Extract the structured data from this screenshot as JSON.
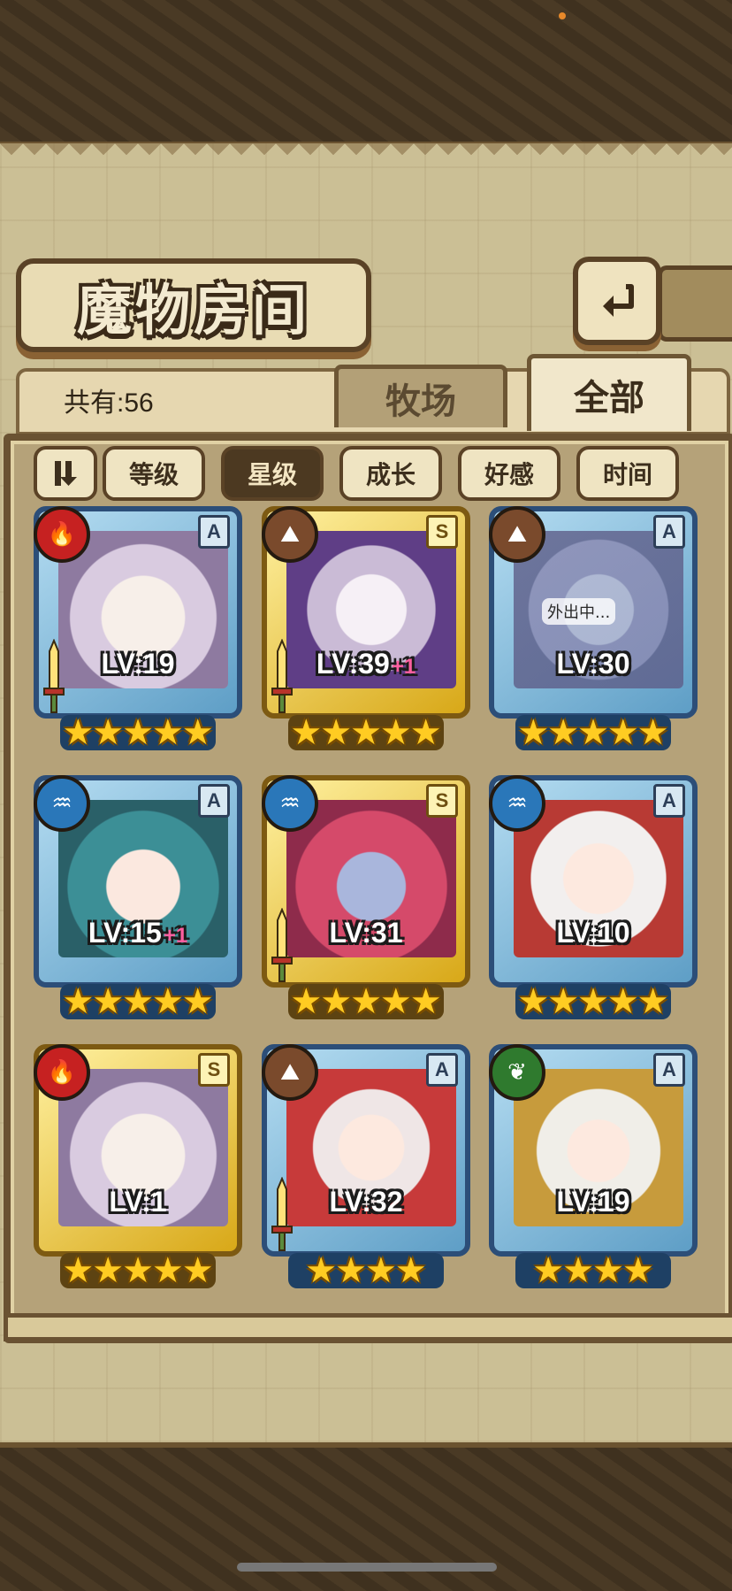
{
  "header": {
    "title": "魔物房间",
    "owned_count": "共有:56"
  },
  "tabs": [
    {
      "label": "牧场",
      "selected": false
    },
    {
      "label": "全部",
      "selected": true
    }
  ],
  "sort": {
    "options": [
      {
        "label": "等级",
        "active": false
      },
      {
        "label": "星级",
        "active": true
      },
      {
        "label": "成长",
        "active": false
      },
      {
        "label": "好感",
        "active": false
      },
      {
        "label": "时间",
        "active": false
      }
    ]
  },
  "monsters": [
    {
      "element": "fire",
      "rank": "A",
      "level": "LV:19",
      "bonus": "",
      "stars": 5,
      "frame": "blue",
      "sword": true,
      "status": ""
    },
    {
      "element": "earth",
      "rank": "S",
      "level": "LV:39",
      "bonus": "+1",
      "stars": 5,
      "frame": "gold",
      "sword": true,
      "status": ""
    },
    {
      "element": "earth",
      "rank": "A",
      "level": "LV:30",
      "bonus": "",
      "stars": 5,
      "frame": "blue",
      "sword": false,
      "status": "外出中..."
    },
    {
      "element": "water",
      "rank": "A",
      "level": "LV:15",
      "bonus": "+1",
      "stars": 5,
      "frame": "blue",
      "sword": false,
      "status": ""
    },
    {
      "element": "water",
      "rank": "S",
      "level": "LV:31",
      "bonus": "",
      "stars": 5,
      "frame": "gold",
      "sword": true,
      "status": ""
    },
    {
      "element": "water",
      "rank": "A",
      "level": "LV:10",
      "bonus": "",
      "stars": 5,
      "frame": "blue",
      "sword": false,
      "status": ""
    },
    {
      "element": "fire",
      "rank": "S",
      "level": "LV:1",
      "bonus": "",
      "stars": 5,
      "frame": "gold",
      "sword": false,
      "status": ""
    },
    {
      "element": "earth",
      "rank": "A",
      "level": "LV:32",
      "bonus": "",
      "stars": 4,
      "frame": "blue",
      "sword": true,
      "status": ""
    },
    {
      "element": "wind",
      "rank": "A",
      "level": "LV:19",
      "bonus": "",
      "stars": 4,
      "frame": "blue",
      "sword": false,
      "status": ""
    }
  ],
  "icons": {
    "back": "return-arrow-icon",
    "sort_toggle": "sort-order-icon",
    "fire": "fire-element-icon",
    "earth": "earth-element-icon",
    "water": "water-element-icon",
    "wind": "wind-element-icon",
    "sword": "sword-icon",
    "star": "star-icon"
  },
  "colors": {
    "panel": "#cbbf95",
    "frame_dark": "#5a4226",
    "active_sort": "#4c3921",
    "star": "#ffcc22"
  }
}
